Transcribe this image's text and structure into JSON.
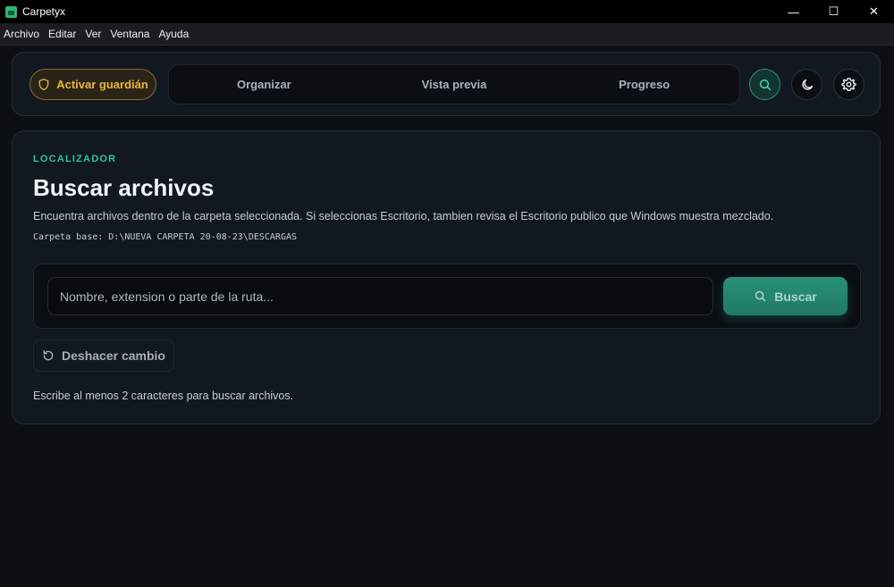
{
  "window": {
    "title": "Carpetyx",
    "minimize_glyph": "—",
    "maximize_glyph": "☐",
    "close_glyph": "✕"
  },
  "menu": {
    "items": [
      "Archivo",
      "Editar",
      "Ver",
      "Ventana",
      "Ayuda"
    ]
  },
  "nav": {
    "guard_label": "Activar guardián",
    "tabs": [
      "Organizar",
      "Vista previa",
      "Progreso"
    ],
    "icons": [
      "search-icon",
      "moon-icon",
      "gear-icon"
    ]
  },
  "main": {
    "eyebrow": "LOCALIZADOR",
    "title": "Buscar archivos",
    "description": "Encuentra archivos dentro de la carpeta seleccionada. Si seleccionas Escritorio, tambien revisa el Escritorio publico que Windows muestra mezclado.",
    "base_path": "Carpeta base: D:\\NUEVA CARPETA 20-08-23\\DESCARGAS",
    "search_placeholder": "Nombre, extension o parte de la ruta...",
    "search_value": "",
    "search_button": "Buscar",
    "undo_button": "Deshacer cambio",
    "hint": "Escribe al menos 2 caracteres para buscar archivos."
  },
  "colors": {
    "accent": "#2ec49a",
    "guard": "#f0b43c",
    "background": "#0c0f14",
    "card": "#121820"
  }
}
